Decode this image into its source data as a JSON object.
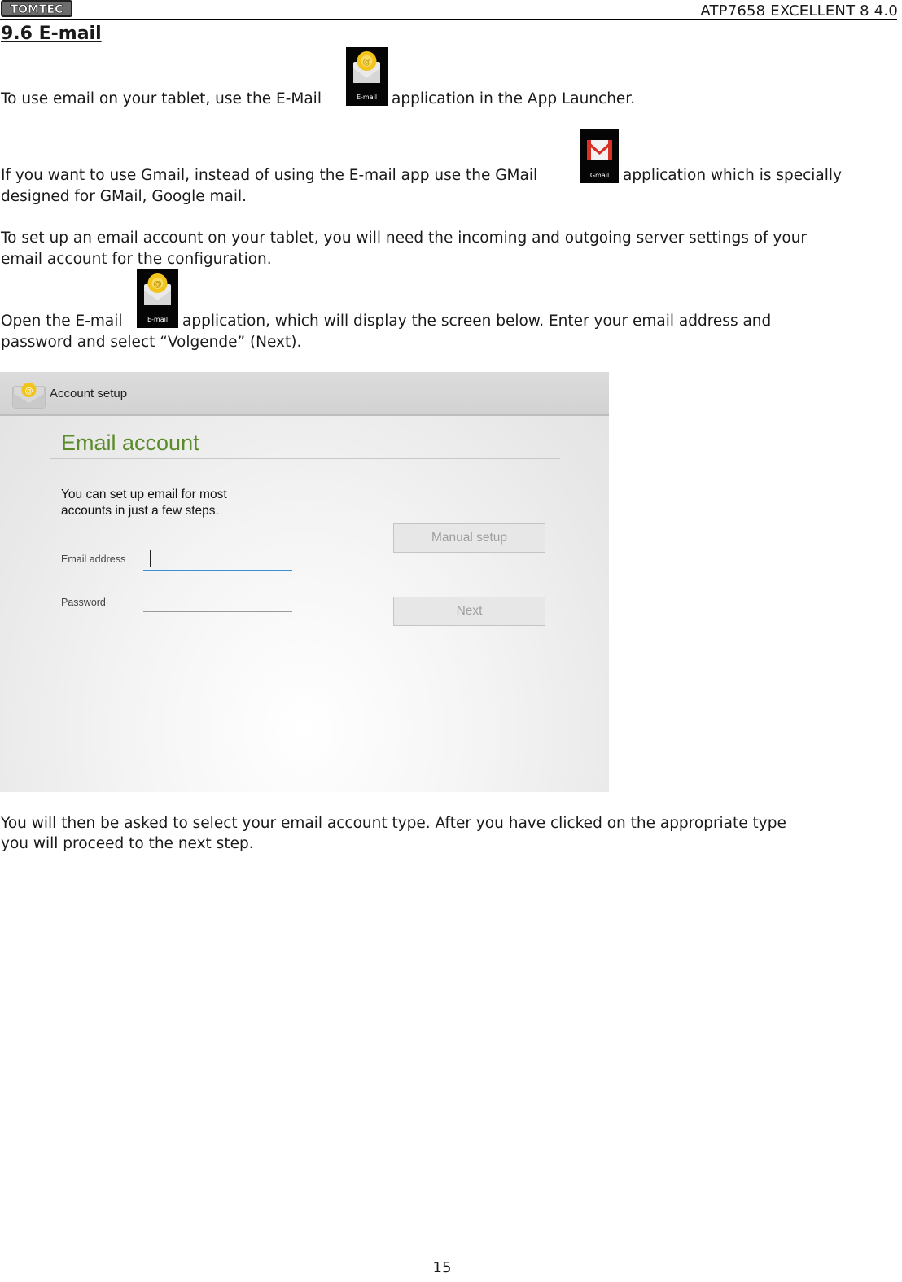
{
  "header": {
    "logo_text": "TOMTEC",
    "doc_title": "ATP7658  EXCELLENT 8  4.0"
  },
  "section": {
    "heading": "9.6 E-mail"
  },
  "paragraphs": {
    "p1_before": "To use email on your tablet, use the E-Mail",
    "p1_after": "application in the App Launcher.",
    "p2_before": "If you want to use Gmail, instead of using the E-mail app use the GMail",
    "p2_after": "application which is specially",
    "p2_line2": "designed for GMail, Google mail.",
    "p3_line1": "To set up an email account on your tablet, you will need the incoming and outgoing server settings of your",
    "p3_line2": "email account for the configuration.",
    "p4_before": "Open the E-mail",
    "p4_after": "application, which will display the screen below. Enter your email address and",
    "p4_line2": "password and select “Volgende” (Next).",
    "p5_line1": "You will then be asked to select your email account type. After you have clicked on the appropriate type",
    "p5_line2": "you will proceed to the next step."
  },
  "icons": {
    "email_label": "E-mail",
    "gmail_label": "Gmail"
  },
  "tablet": {
    "bar_title": "Account setup",
    "title": "Email account",
    "intro": "You can set up email for most\naccounts in just a few steps.",
    "email_label": "Email address",
    "password_label": "Password",
    "manual_setup": "Manual setup",
    "next": "Next",
    "accent_green": "#5b8b2a",
    "accent_blue": "#3c8fd0"
  },
  "footer": {
    "page_number": "15"
  }
}
